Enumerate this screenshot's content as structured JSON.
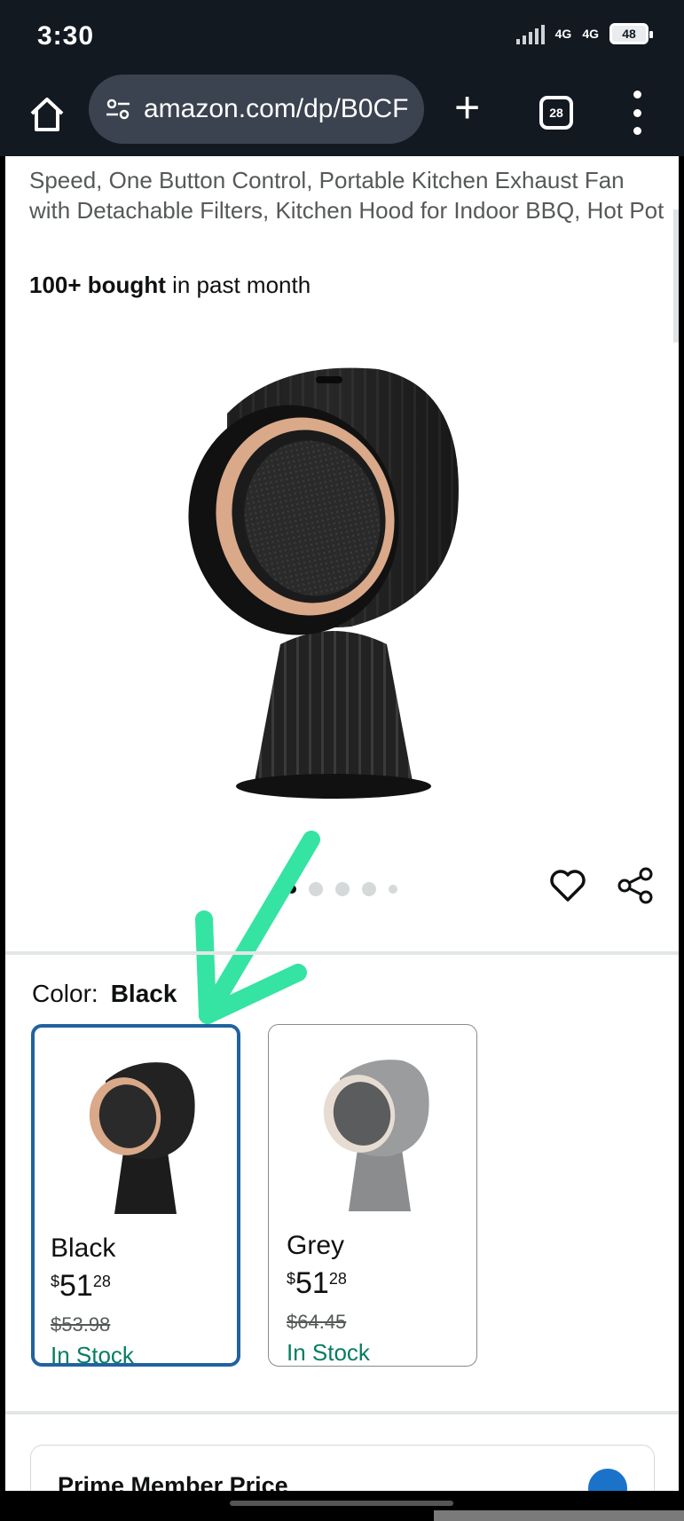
{
  "status_bar": {
    "time": "3:30",
    "network_1": "4G",
    "network_2": "4G",
    "battery": "48"
  },
  "browser": {
    "url": "amazon.com/dp/B0CF",
    "tab_count": "28"
  },
  "product": {
    "title": "Speed, One Button Control, Portable Kitchen Exhaust Fan with Detachable Filters, Kitchen Hood for Indoor BBQ, Hot Pot",
    "bought_bold": "100+ bought",
    "bought_rest": " in past month"
  },
  "color": {
    "label": "Color:",
    "selected_value": "Black",
    "options": [
      {
        "name": "Black",
        "price_symbol": "$",
        "price_whole": "51",
        "price_cents": "28",
        "list_price": "$53.98",
        "stock": "In Stock",
        "selected": true
      },
      {
        "name": "Grey",
        "price_symbol": "$",
        "price_whole": "51",
        "price_cents": "28",
        "list_price": "$64.45",
        "stock": "In Stock",
        "selected": false
      }
    ]
  },
  "prime": {
    "label": "Prime Member Price"
  },
  "colors": {
    "header_bg": "#131921",
    "selected_border": "#2162a1",
    "in_stock": "#067d62",
    "annotation_arrow": "#35e3a3"
  },
  "icons": {
    "home": "home-icon",
    "site_settings": "tune-icon",
    "new_tab": "plus-icon",
    "tabs": "tabs-icon",
    "menu": "more-vert-icon",
    "wishlist": "heart-icon",
    "share": "share-icon"
  },
  "image_carousel": {
    "dot_count": 5,
    "active_index": 0
  }
}
